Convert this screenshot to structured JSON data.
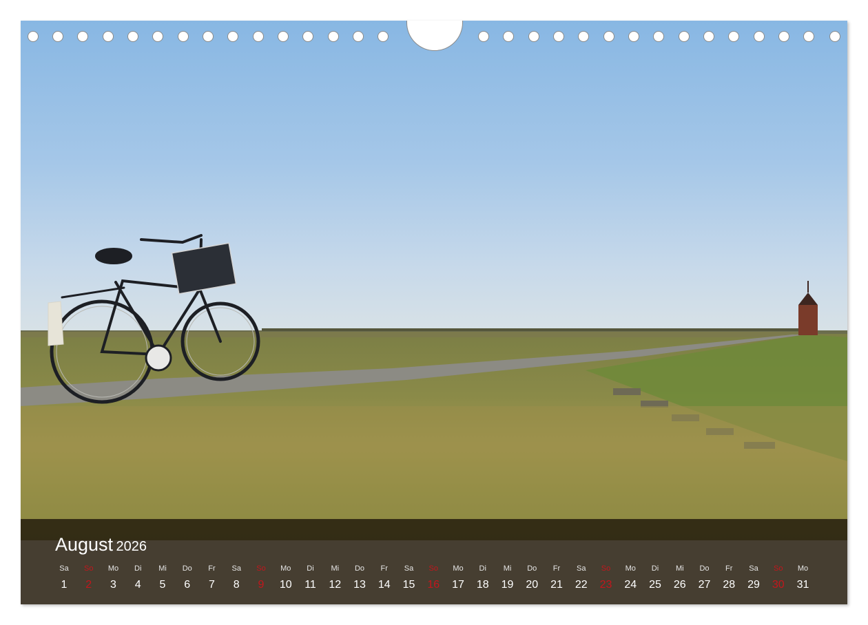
{
  "calendar": {
    "month": "August",
    "year": "2026",
    "days": [
      {
        "abbr": "Sa",
        "num": "1",
        "sunday": false
      },
      {
        "abbr": "So",
        "num": "2",
        "sunday": true
      },
      {
        "abbr": "Mo",
        "num": "3",
        "sunday": false
      },
      {
        "abbr": "Di",
        "num": "4",
        "sunday": false
      },
      {
        "abbr": "Mi",
        "num": "5",
        "sunday": false
      },
      {
        "abbr": "Do",
        "num": "6",
        "sunday": false
      },
      {
        "abbr": "Fr",
        "num": "7",
        "sunday": false
      },
      {
        "abbr": "Sa",
        "num": "8",
        "sunday": false
      },
      {
        "abbr": "So",
        "num": "9",
        "sunday": true
      },
      {
        "abbr": "Mo",
        "num": "10",
        "sunday": false
      },
      {
        "abbr": "Di",
        "num": "11",
        "sunday": false
      },
      {
        "abbr": "Mi",
        "num": "12",
        "sunday": false
      },
      {
        "abbr": "Do",
        "num": "13",
        "sunday": false
      },
      {
        "abbr": "Fr",
        "num": "14",
        "sunday": false
      },
      {
        "abbr": "Sa",
        "num": "15",
        "sunday": false
      },
      {
        "abbr": "So",
        "num": "16",
        "sunday": true
      },
      {
        "abbr": "Mo",
        "num": "17",
        "sunday": false
      },
      {
        "abbr": "Di",
        "num": "18",
        "sunday": false
      },
      {
        "abbr": "Mi",
        "num": "19",
        "sunday": false
      },
      {
        "abbr": "Do",
        "num": "20",
        "sunday": false
      },
      {
        "abbr": "Fr",
        "num": "21",
        "sunday": false
      },
      {
        "abbr": "Sa",
        "num": "22",
        "sunday": false
      },
      {
        "abbr": "So",
        "num": "23",
        "sunday": true
      },
      {
        "abbr": "Mo",
        "num": "24",
        "sunday": false
      },
      {
        "abbr": "Di",
        "num": "25",
        "sunday": false
      },
      {
        "abbr": "Mi",
        "num": "26",
        "sunday": false
      },
      {
        "abbr": "Do",
        "num": "27",
        "sunday": false
      },
      {
        "abbr": "Fr",
        "num": "28",
        "sunday": false
      },
      {
        "abbr": "Sa",
        "num": "29",
        "sunday": false
      },
      {
        "abbr": "So",
        "num": "30",
        "sunday": true
      },
      {
        "abbr": "Mo",
        "num": "31",
        "sunday": false
      }
    ]
  },
  "photo": {
    "subjects": [
      "bicycle-with-basket",
      "dike-path",
      "grass-field",
      "lighthouse-tower"
    ]
  },
  "colors": {
    "sunday": "#c3161c",
    "panel": "#2a1e0f",
    "sky_top": "#88b7e3"
  }
}
